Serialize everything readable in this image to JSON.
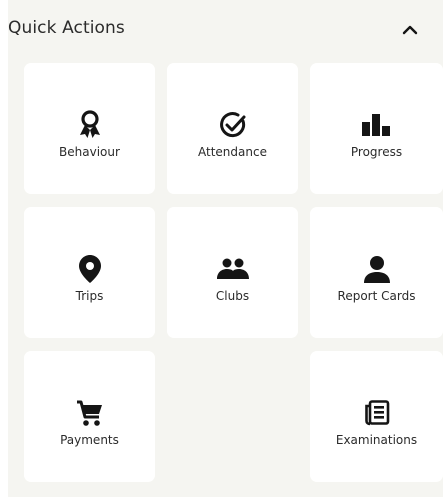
{
  "panel": {
    "title": "Quick Actions",
    "collapse_icon": "chevron-up-icon"
  },
  "actions": [
    {
      "label": "Behaviour",
      "icon": "award-ribbon-icon"
    },
    {
      "label": "Attendance",
      "icon": "check-circle-icon"
    },
    {
      "label": "Progress",
      "icon": "podium-bars-icon"
    },
    {
      "label": "Trips",
      "icon": "map-pin-icon"
    },
    {
      "label": "Clubs",
      "icon": "group-people-icon"
    },
    {
      "label": "Report Cards",
      "icon": "person-icon"
    },
    {
      "label": "Payments",
      "icon": "shopping-cart-icon"
    },
    {
      "label": "Examinations",
      "icon": "newspaper-icon"
    }
  ],
  "colors": {
    "panel_bg": "#f5f5f1",
    "tile_bg": "#ffffff",
    "text": "#2b2b2b",
    "icon": "#151515"
  }
}
